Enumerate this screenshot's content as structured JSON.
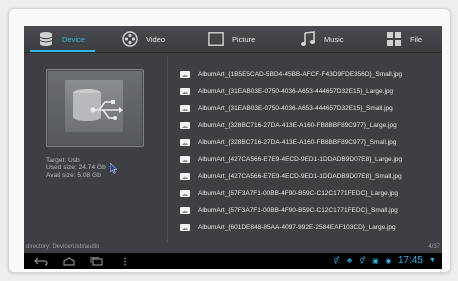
{
  "tabs": [
    {
      "label": "Device",
      "icon": "database-icon",
      "active": true
    },
    {
      "label": "Video",
      "icon": "film-reel-icon",
      "active": false
    },
    {
      "label": "Picture",
      "icon": "picture-frame-icon",
      "active": false
    },
    {
      "label": "Music",
      "icon": "music-note-icon",
      "active": false
    },
    {
      "label": "File",
      "icon": "grid-icon",
      "active": false
    }
  ],
  "device": {
    "target": "Target: Usb",
    "used": "Used size: 24.74 Gb",
    "avail": "Avail size: 5.08 Gb"
  },
  "files": [
    "AlbumArt_{1B5E5CAD-5BD4-45BB-AFCF-F43D9FDE356D}_Small.jpg",
    "AlbumArt_{31EAB03E-0750-4036-A653-444657D32E15}_Large.jpg",
    "AlbumArt_{31EAB03E-0750-4036-A653-444657D32E15}_Small.jpg",
    "AlbumArt_{328BC716-27DA-413E-A160-FB8BBF89C977}_Large.jpg",
    "AlbumArt_{328BC716-27DA-413E-A160-FB8BBF89C977}_Small.jpg",
    "AlbumArt_{427CA566-E7E9-4ECD-9ED1-1DDADB9D07E8}_Large.jpg",
    "AlbumArt_{427CA566-E7E9-4ECD-9ED1-1DDADB9D07E8}_Small.jpg",
    "AlbumArt_{57F3A7F1-00BB-4F90-B59C-C12C1771FEDC}_Large.jpg",
    "AlbumArt_{57F3A7F1-00BB-4F90-B59C-C12C1771FEDC}_Small.jpg",
    "AlbumArt_{601DE848-85AA-4097-992E-2584EAF103CD}_Large.jpg"
  ],
  "status": {
    "directory": "directory: Device/Usb/audio",
    "count": "4/37"
  },
  "clock": "17:45",
  "colors": {
    "accent": "#33b5e5",
    "background": "#3d3f42"
  }
}
